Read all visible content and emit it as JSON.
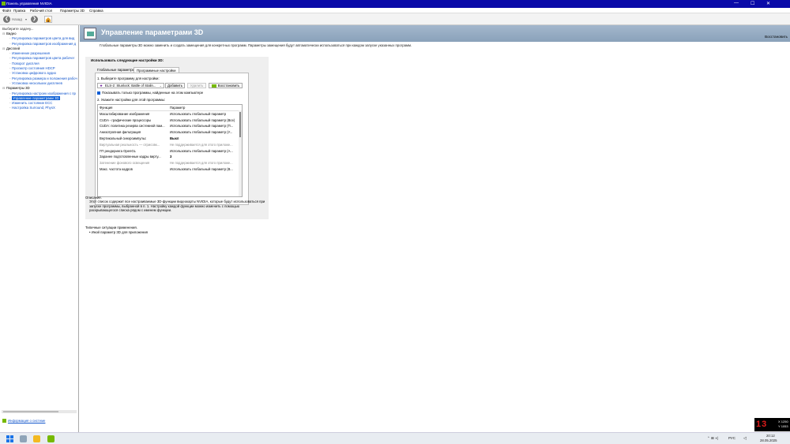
{
  "window": {
    "title": "Панель управления NVIDIA",
    "min_glyph": "—",
    "max_glyph": "☐",
    "close_glyph": "✕"
  },
  "menu": [
    "Файл",
    "Правка",
    "Рабочий стол",
    "Параметры 3D",
    "Справка"
  ],
  "toolbar": {
    "back_label": "Назад",
    "back_glyph": "❮",
    "forward_glyph": "❯",
    "back_icon": "back-arrow-icon",
    "forward_icon": "forward-arrow-icon",
    "home_icon": "home-icon"
  },
  "sidebar": {
    "header": "Выберите задачу...",
    "tree": [
      {
        "label": "Видео",
        "kind": "category"
      },
      {
        "label": "Регулировка параметров цвета для вид",
        "kind": "leaf"
      },
      {
        "label": "Регулировка параметров изображения д",
        "kind": "leaf"
      },
      {
        "label": "Дисплей",
        "kind": "category"
      },
      {
        "label": "Изменение разрешения",
        "kind": "leaf"
      },
      {
        "label": "Регулировка параметров цвета рабочег",
        "kind": "leaf"
      },
      {
        "label": "Поворот дисплея",
        "kind": "leaf"
      },
      {
        "label": "Просмотр состояния HDCP",
        "kind": "leaf"
      },
      {
        "label": "Установка цифрового аудио",
        "kind": "leaf"
      },
      {
        "label": "Регулировка размера и положения рабоч",
        "kind": "leaf"
      },
      {
        "label": "Установка нескольких дисплеев",
        "kind": "leaf"
      },
      {
        "label": "Параметры 3D",
        "kind": "category"
      },
      {
        "label": "Регулировка настроек изображения с пр",
        "kind": "leaf"
      },
      {
        "label": "Управление параметрами 3D",
        "kind": "leaf",
        "selected": true
      },
      {
        "label": "Изменить состояние ECC",
        "kind": "leaf"
      },
      {
        "label": "Настройка Surround, PhysX",
        "kind": "leaf"
      }
    ],
    "system_info": "Информация о системе"
  },
  "banner": {
    "title": "Управление параметрами 3D",
    "restore": "Восстановить"
  },
  "intro": "Глобальные параметры 3D можно заменить и создать замещения для конкретных программ. Параметры замещения будут автоматически использоваться при каждом запуске указанных программ.",
  "panel": {
    "use_heading": "Использовать следующие настройки 3D:",
    "tabs": [
      "Глобальные параметры",
      "Программные настройки"
    ],
    "step1": "1. Выберите программу для настройки:",
    "program": "ELS-2: Stunlock: Battle of Stalin...",
    "combo_arrow": "⌄",
    "add_button": "Добавить",
    "remove_button": "Удалить",
    "restore_button": "Восстановить",
    "checkbox_label": "Показывать только программы, найденные на этом компьютере",
    "step2": "2. Укажите настройки для этой программы:",
    "grid_headers": [
      "Функция",
      "Параметр"
    ],
    "grid_rows": [
      {
        "feature": "Масштабирование изображения",
        "value": "Использовать глобальный параметр",
        "state": "normal"
      },
      {
        "feature": "CUDA - графические процессоры",
        "value": "Использовать глобальный параметр (Все)",
        "state": "normal"
      },
      {
        "feature": "CUDA: политика резерва системной пам...",
        "value": "Использовать глобальный параметр (П...",
        "state": "normal"
      },
      {
        "feature": "Анизотропная фильтрация",
        "value": "Использовать глобальный параметр (У...",
        "state": "normal"
      },
      {
        "feature": "Вертикальный синхроимпульс",
        "value": "Выкл",
        "state": "bold"
      },
      {
        "feature": "Виртуальная реальность — отрисовк...",
        "value": "Не поддерживается для этого приложе...",
        "state": "grey"
      },
      {
        "feature": "ГП рендеринга OpenGL",
        "value": "Использовать глобальный параметр (А...",
        "state": "normal"
      },
      {
        "feature": "Заранее подготовленные кадры вирту...",
        "value": "3",
        "state": "bold"
      },
      {
        "feature": "Затенение фонового освещения",
        "value": "Не поддерживается для этого приложе...",
        "state": "grey"
      },
      {
        "feature": "Макс. частота кадров",
        "value": "Использовать глобальный параметр (В...",
        "state": "normal"
      }
    ]
  },
  "description": {
    "heading": "Описание.",
    "lines": [
      "Этот список содержит все настраиваемые 3D-функции видеокарты NVIDIA, которые будут использоваться при",
      "запуске программы, выбранной в п. 1. Настройку каждой функции можно изменить с помощью",
      "раскрывающегося списка рядом с именем функции."
    ]
  },
  "usage": {
    "heading": "Типичные ситуации применения.",
    "item": "Иной параметр 3D для приложения"
  },
  "overlay": {
    "fps": "13",
    "x": "X 1250",
    "y": "Y 1053"
  },
  "taskbar": {
    "lang": "РУС",
    "time": "20:12",
    "date": "28.05.2025",
    "tray_icons": "⌃  ⊞  ◖)"
  },
  "colors": {
    "titlebar": "#0a0aa8",
    "selection": "#0a5dd4",
    "nvidia_green": "#76b900",
    "banner": "#8aa2ba"
  }
}
